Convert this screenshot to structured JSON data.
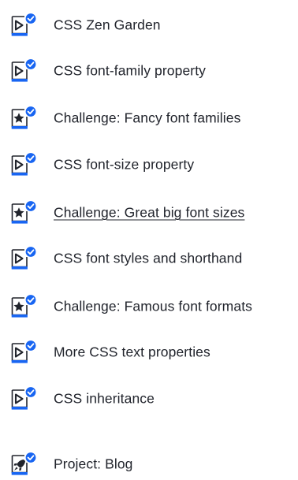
{
  "colors": {
    "accent": "#1865f2",
    "icon_dark": "#21242c",
    "text": "#21242c",
    "background": "#ffffff"
  },
  "lessons": [
    {
      "label": "CSS Zen Garden",
      "icon": "video-play-icon",
      "completed": true,
      "underlined": false
    },
    {
      "label": "CSS font-family property",
      "icon": "video-play-icon",
      "completed": true,
      "underlined": false
    },
    {
      "label": "Challenge: Fancy font families",
      "icon": "challenge-star-icon",
      "completed": true,
      "underlined": false
    },
    {
      "label": "CSS font-size property",
      "icon": "video-play-icon",
      "completed": true,
      "underlined": false
    },
    {
      "label": "Challenge: Great big font sizes",
      "icon": "challenge-star-icon",
      "completed": true,
      "underlined": true
    },
    {
      "label": "CSS font styles and shorthand",
      "icon": "video-play-icon",
      "completed": true,
      "underlined": false
    },
    {
      "label": "Challenge: Famous font formats",
      "icon": "challenge-star-icon",
      "completed": true,
      "underlined": false
    },
    {
      "label": "More CSS text properties",
      "icon": "video-play-icon",
      "completed": true,
      "underlined": false
    },
    {
      "label": "CSS inheritance",
      "icon": "video-play-icon",
      "completed": true,
      "underlined": false
    },
    {
      "label": "Project: Blog",
      "icon": "project-rocket-icon",
      "completed": true,
      "underlined": false
    }
  ]
}
